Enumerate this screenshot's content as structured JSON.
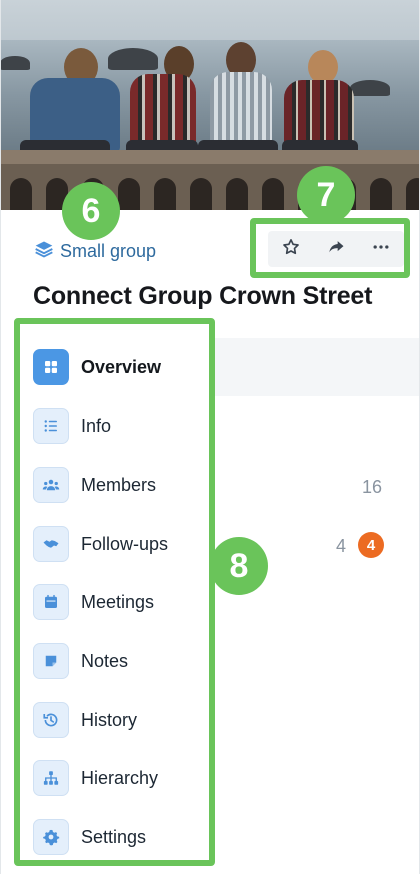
{
  "group": {
    "type_label": "Small group",
    "title": "Connect Group Crown Street"
  },
  "callouts": {
    "group_type": "6",
    "actions": "7",
    "navigation": "8"
  },
  "actions": {
    "favorite_icon": "star-icon",
    "share_icon": "share-icon",
    "more_icon": "more-icon"
  },
  "nav": {
    "items": [
      {
        "label": "Overview",
        "icon": "grid-icon",
        "active": true
      },
      {
        "label": "Info",
        "icon": "list-icon"
      },
      {
        "label": "Members",
        "icon": "people-icon"
      },
      {
        "label": "Follow-ups",
        "icon": "handshake-icon"
      },
      {
        "label": "Meetings",
        "icon": "calendar-icon"
      },
      {
        "label": "Notes",
        "icon": "note-icon"
      },
      {
        "label": "History",
        "icon": "history-icon"
      },
      {
        "label": "Hierarchy",
        "icon": "hierarchy-icon"
      },
      {
        "label": "Settings",
        "icon": "gear-icon"
      }
    ]
  },
  "counts": {
    "members": "16",
    "followups": "4",
    "followups_alert": "4"
  },
  "colors": {
    "callout_green": "#6ac45a",
    "link_blue": "#2e6a9e",
    "active_blue": "#4b97e4",
    "alert_orange": "#ec6b22"
  }
}
